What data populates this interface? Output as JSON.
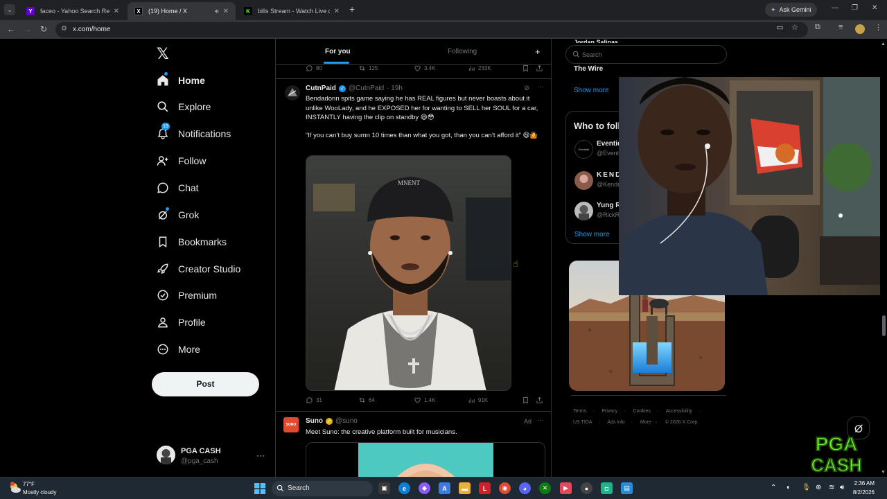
{
  "browser": {
    "tabs": [
      {
        "title": "faceo - Yahoo Search Results",
        "favicon": "Y",
        "favicon_color": "#6001d2"
      },
      {
        "title": "(19) Home / X",
        "favicon": "X",
        "favicon_color": "#000000"
      },
      {
        "title": "bills Stream - Watch Live on Kick",
        "favicon": "K",
        "favicon_color": "#53fc18"
      }
    ],
    "ask_gemini": "Ask Gemini",
    "url": "x.com/home"
  },
  "x": {
    "nav": [
      {
        "label": "Home",
        "icon": "home-icon"
      },
      {
        "label": "Explore",
        "icon": "search-icon"
      },
      {
        "label": "Notifications",
        "icon": "bell-icon",
        "badge": "19"
      },
      {
        "label": "Follow",
        "icon": "add-person-icon"
      },
      {
        "label": "Chat",
        "icon": "chat-icon"
      },
      {
        "label": "Grok",
        "icon": "grok-icon"
      },
      {
        "label": "Bookmarks",
        "icon": "bookmark-icon"
      },
      {
        "label": "Creator Studio",
        "icon": "rocket-icon"
      },
      {
        "label": "Premium",
        "icon": "premium-icon"
      },
      {
        "label": "Profile",
        "icon": "person-icon"
      },
      {
        "label": "More",
        "icon": "more-circle-icon"
      }
    ],
    "post_button": "Post",
    "profile": {
      "name": "PGA CASH",
      "handle": "@pga_cash"
    },
    "feed_tabs": {
      "for_you": "For you",
      "following": "Following"
    },
    "prev_tweet_actions": {
      "replies": "80",
      "reposts": "125",
      "likes": "3.4K",
      "views": "233K"
    },
    "tweet": {
      "name": "CutnPaid",
      "handle": "@CutnPaid",
      "time": "· 19h",
      "text1": "Bendadonn spits game saying he has REAL figures but never boasts about it unlike WooLady, and he EXPOSED her for wanting to SELL her SOUL for a car, INSTANTLY having the clip on standby 😆😳",
      "text2": "“If you can’t buy sumn 10 times than what you got, than you can’t afford it” 😆🤷",
      "hat_text": "MNENT",
      "actions": {
        "replies": "31",
        "reposts": "64",
        "likes": "1.4K",
        "views": "91K"
      }
    },
    "ad_tweet": {
      "name": "Suno",
      "handle": "@suno",
      "ad_label": "Ad",
      "text": "Meet Suno: the creative platform built for musicians.",
      "avatar_text": "SUNO"
    },
    "right": {
      "search_placeholder": "Search",
      "trend_partial": "Jordan Salinas",
      "trend_wire": "The Wire",
      "show_more": "Show more",
      "who_to_follow": "Who to follow",
      "follow_suggestions": [
        {
          "name": "Eventide",
          "handle": "@EventideAudio",
          "avatar_text": "Eventide"
        },
        {
          "name": "KENDRICK",
          "handle": "@KendrickLamar"
        },
        {
          "name": "Yung Rick",
          "handle": "@RickRoss"
        }
      ],
      "footer": [
        "Terms",
        "·",
        "Privacy",
        "·",
        "Cookies",
        "·",
        "Accessibility",
        "·",
        "US TIDA",
        "·",
        "Ads info",
        "·",
        "More ···",
        "© 2026 X Corp."
      ]
    },
    "overlay_logo": "PGA CASH"
  },
  "taskbar": {
    "weather_temp": "77°F",
    "weather_desc": "Mostly cloudy",
    "search_placeholder": "Search",
    "time": "2:36 AM",
    "date": "8/2/2026"
  }
}
